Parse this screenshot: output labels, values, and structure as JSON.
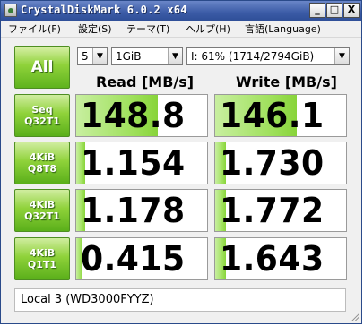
{
  "window": {
    "title": "CrystalDiskMark 6.0.2 x64"
  },
  "titlebar_buttons": {
    "minimize": "_",
    "maximize": "□",
    "close": "X"
  },
  "menu": [
    {
      "label": "ファイル(F)"
    },
    {
      "label": "設定(S)"
    },
    {
      "label": "テーマ(T)"
    },
    {
      "label": "ヘルプ(H)"
    },
    {
      "label": "言語(Language)"
    }
  ],
  "controls": {
    "all_label": "All",
    "count": "5",
    "size": "1GiB",
    "drive": "I: 61% (1714/2794GiB)"
  },
  "headers": {
    "read": "Read [MB/s]",
    "write": "Write [MB/s]"
  },
  "rows": [
    {
      "line1": "Seq",
      "line2": "Q32T1",
      "read": "148.8",
      "write": "146.1",
      "read_fill": 0.62,
      "write_fill": 0.62
    },
    {
      "line1": "4KiB",
      "line2": "Q8T8",
      "read": "1.154",
      "write": "1.730",
      "read_fill": 0.07,
      "write_fill": 0.08
    },
    {
      "line1": "4KiB",
      "line2": "Q32T1",
      "read": "1.178",
      "write": "1.772",
      "read_fill": 0.07,
      "write_fill": 0.08
    },
    {
      "line1": "4KiB",
      "line2": "Q1T1",
      "read": "0.415",
      "write": "1.643",
      "read_fill": 0.05,
      "write_fill": 0.08
    }
  ],
  "comment": "Local 3 (WD3000FYYZ)",
  "colors": {
    "accent_green": "#8fd23a",
    "titlebar_blue": "#3b5ba6"
  }
}
